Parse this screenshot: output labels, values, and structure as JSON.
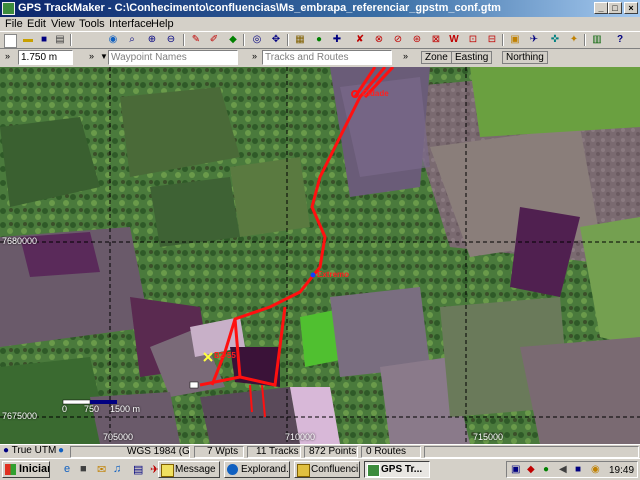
{
  "window": {
    "title": "GPS TrackMaker - C:\\Conhecimento\\confluencias\\Ms_embrapa_referenciar_gpstm_conf.gtm",
    "controls": {
      "minimize": "_",
      "maximize": "□",
      "close": "×"
    }
  },
  "menu": [
    "File",
    "Edit",
    "View",
    "Tools",
    "Interface",
    "Help"
  ],
  "toolbar": {
    "icons": [
      "new-icon",
      "open-icon",
      "save-icon",
      "print-icon",
      "gps-icon",
      "zoom-icon",
      "zoom-in-icon",
      "zoom-out-icon",
      "pencil-icon",
      "pen-icon",
      "gem-icon",
      "eye-icon",
      "ruler-icon",
      "target-icon",
      "xy-icon",
      "find-icon",
      "filter-icon",
      "track-icon",
      "waypoint-icon",
      "route-icon",
      "text-icon",
      "map-icon",
      "lock-icon",
      "tag-icon",
      "book-icon",
      "help-icon"
    ]
  },
  "bar2": {
    "scale": "1.750 m",
    "waypoint_placeholder": "Waypoint Names",
    "tracks_placeholder": "Tracks and Routes",
    "headers": [
      "Zone",
      "Easting",
      "Northing"
    ]
  },
  "map": {
    "coord_labels": {
      "y_top": "7680000",
      "y_bottom": "7675000",
      "x_left": "705000",
      "x_mid": "710000",
      "x_right": "715000"
    },
    "scale_bar": {
      "start": "0",
      "mid": "750",
      "end": "1500 m"
    },
    "waypoints": [
      {
        "name": "Extremo"
      },
      {
        "name": "B2-55"
      },
      {
        "name": "Cidade"
      }
    ]
  },
  "status": {
    "projection": "True UTM",
    "datum": "WGS 1984 (GPS)",
    "waypoints": "7 Wpts",
    "tracks": "11 Tracks",
    "points": "872 Points",
    "routes": "0 Routes"
  },
  "taskbar": {
    "start": "Iniciar",
    "tasks": [
      "Message ...",
      "Explorand...",
      "Confluenci...",
      "GPS Tr..."
    ],
    "clock": "19:49"
  }
}
